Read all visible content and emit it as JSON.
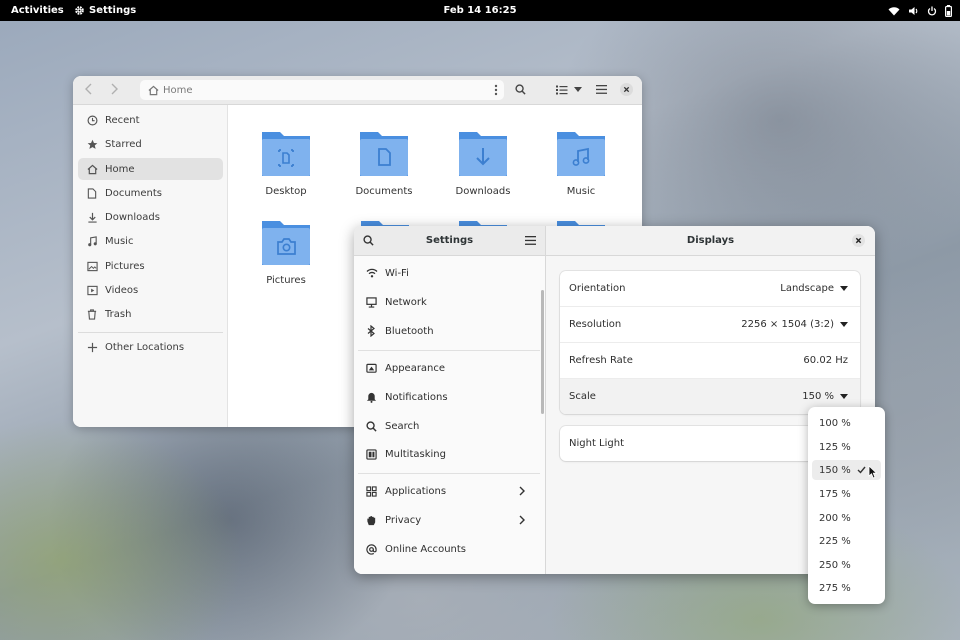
{
  "topbar": {
    "activities": "Activities",
    "app_name": "Settings",
    "clock": "Feb 14  16:25",
    "icons": [
      "wifi-icon",
      "volume-icon",
      "power-icon",
      "battery-icon"
    ]
  },
  "files": {
    "path": "Home",
    "sidebar": [
      {
        "label": "Recent",
        "icon": "clock-icon"
      },
      {
        "label": "Starred",
        "icon": "star-icon"
      },
      {
        "label": "Home",
        "icon": "home-icon",
        "selected": true
      },
      {
        "label": "Documents",
        "icon": "document-icon"
      },
      {
        "label": "Downloads",
        "icon": "download-icon"
      },
      {
        "label": "Music",
        "icon": "music-icon"
      },
      {
        "label": "Pictures",
        "icon": "picture-icon"
      },
      {
        "label": "Videos",
        "icon": "video-icon"
      },
      {
        "label": "Trash",
        "icon": "trash-icon"
      },
      {
        "label": "Other Locations",
        "icon": "plus-icon"
      }
    ],
    "folders": [
      {
        "label": "Desktop",
        "icon": "desktop-folder-icon"
      },
      {
        "label": "Documents",
        "icon": "documents-folder-icon"
      },
      {
        "label": "Downloads",
        "icon": "downloads-folder-icon"
      },
      {
        "label": "Music",
        "icon": "music-folder-icon"
      },
      {
        "label": "Pictures",
        "icon": "pictures-folder-icon"
      }
    ]
  },
  "settings": {
    "sidebar_title": "Settings",
    "page_title": "Displays",
    "nav": [
      {
        "label": "Wi-Fi",
        "icon": "wifi-icon"
      },
      {
        "label": "Network",
        "icon": "network-icon"
      },
      {
        "label": "Bluetooth",
        "icon": "bluetooth-icon"
      },
      {
        "label": "Appearance",
        "icon": "appearance-icon"
      },
      {
        "label": "Notifications",
        "icon": "bell-icon"
      },
      {
        "label": "Search",
        "icon": "search-icon"
      },
      {
        "label": "Multitasking",
        "icon": "multitasking-icon"
      },
      {
        "label": "Applications",
        "icon": "grid-icon",
        "submenu": true
      },
      {
        "label": "Privacy",
        "icon": "hand-icon",
        "submenu": true
      },
      {
        "label": "Online Accounts",
        "icon": "at-icon"
      }
    ],
    "display": {
      "orientation_label": "Orientation",
      "orientation_value": "Landscape",
      "resolution_label": "Resolution",
      "resolution_value": "2256 × 1504 (3:2)",
      "refresh_label": "Refresh Rate",
      "refresh_value": "60.02 Hz",
      "scale_label": "Scale",
      "scale_value": "150 %",
      "night_light_label": "Night Light"
    },
    "scale_options": [
      "100 %",
      "125 %",
      "150 %",
      "175 %",
      "200 %",
      "225 %",
      "250 %",
      "275 %"
    ],
    "scale_selected": "150 %"
  },
  "colors": {
    "folder": "#5b9be6",
    "folder_light": "#8cbcf2",
    "topbar": "#000000"
  }
}
